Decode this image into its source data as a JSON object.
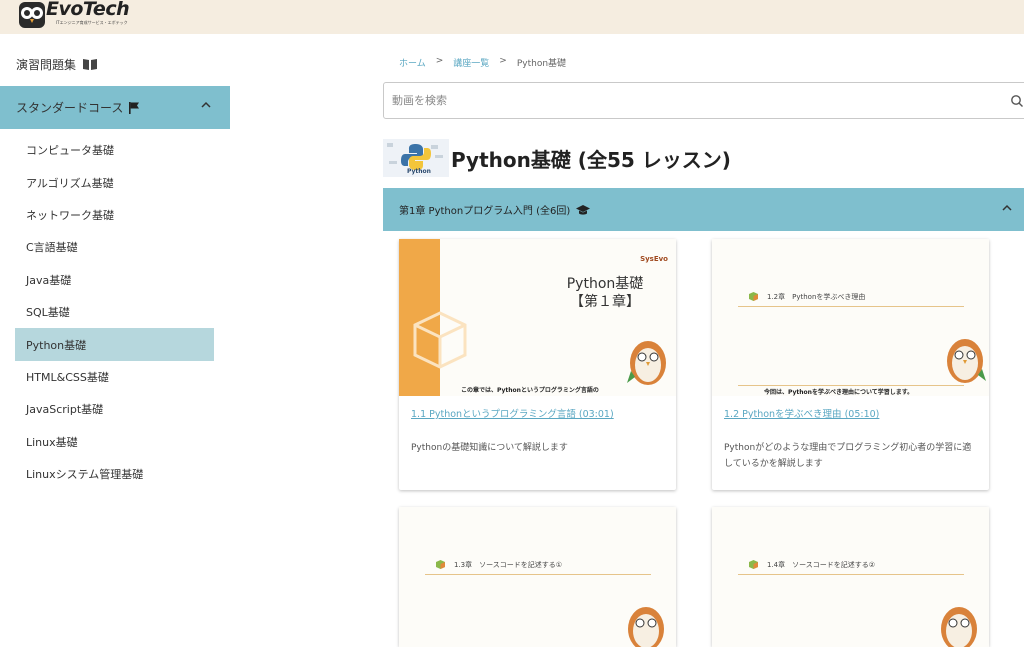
{
  "header": {
    "logo_text": "EvoTech",
    "logo_sub": "ITエンジニア育成サービス・エボテック"
  },
  "sidebar": {
    "top_label": "演習問題集",
    "section_label": "スタンダードコース",
    "items": [
      {
        "label": "コンピュータ基礎"
      },
      {
        "label": "アルゴリズム基礎"
      },
      {
        "label": "ネットワーク基礎"
      },
      {
        "label": "C言語基礎"
      },
      {
        "label": "Java基礎"
      },
      {
        "label": "SQL基礎"
      },
      {
        "label": "Python基礎",
        "active": true
      },
      {
        "label": "HTML&CSS基礎"
      },
      {
        "label": "JavaScript基礎"
      },
      {
        "label": "Linux基礎"
      },
      {
        "label": "Linuxシステム管理基礎"
      }
    ]
  },
  "breadcrumb": {
    "home": "ホーム",
    "sep": ">",
    "courses": "講座一覧",
    "current": "Python基礎"
  },
  "search": {
    "placeholder": "動画を検索"
  },
  "course": {
    "thumb_label": "Python",
    "title": "Python基礎 (全55 レッスン)"
  },
  "chapter": {
    "label": "第1章 Pythonプログラム入門 (全6回)"
  },
  "cards": [
    {
      "thumb_title": "Python基礎\n【第１章】",
      "thumb_brand": "SysEvo",
      "thumb_caption": "この章では、Pythonというプログラミング言語の",
      "link": "1.1 Pythonというプログラミング言語 (03:01)",
      "desc": "Pythonの基礎知識について解説します"
    },
    {
      "thumb_heading": "1.2章　Pythonを学ぶべき理由",
      "thumb_caption": "今回は、Pythonを学ぶべき理由について学習します。",
      "link": "1.2 Pythonを学ぶべき理由 (05:10)",
      "desc": "Pythonがどのような理由でプログラミング初心者の学習に適しているかを解説します"
    },
    {
      "thumb_heading": "1.3章　ソースコードを記述する①"
    },
    {
      "thumb_heading": "1.4章　ソースコードを記述する②"
    }
  ],
  "colors": {
    "header_bg": "#f5ede0",
    "accent": "#7fbfce",
    "active_bg": "#b6d7dd",
    "link": "#5aa7c2",
    "orange": "#f0a848"
  }
}
